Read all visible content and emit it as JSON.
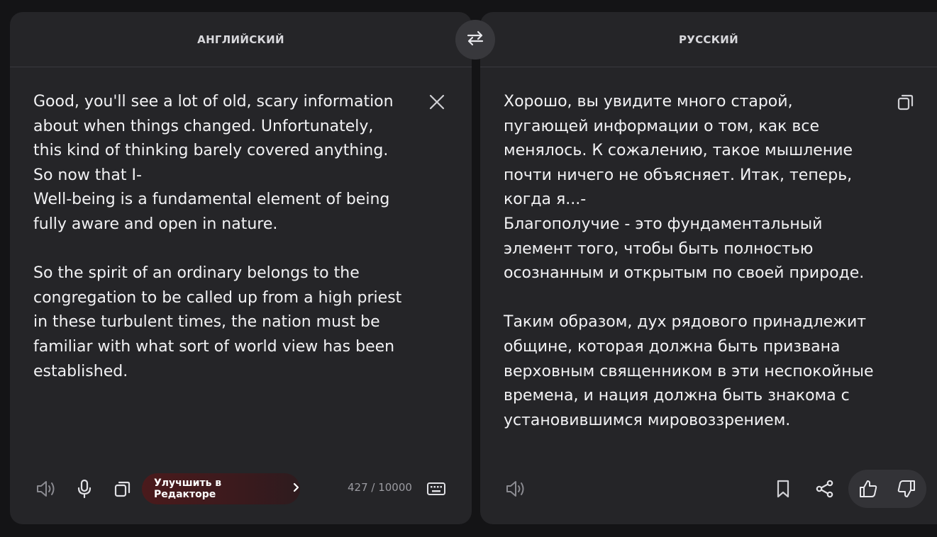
{
  "source": {
    "language": "АНГЛИЙСКИЙ",
    "text": "Good, you'll see a lot of old, scary information\nabout when things changed. Unfortunately,\nthis kind of thinking barely covered anything.\nSo now that I-\nWell-being is a fundamental element of being\nfully aware and open in nature.\n\nSo the spirit of an ordinary belongs to the\ncongregation to be called up from a high priest\nin these turbulent times, the nation must be\nfamiliar with what sort of world view has been\nestablished.",
    "improve_button_label": "Улучшить в Редакторе",
    "char_count": "427 / 10000"
  },
  "target": {
    "language": "РУССКИЙ",
    "text": "Хорошо, вы увидите много старой,\nпугающей информации о том, как все\nменялось. К сожалению, такое мышление\nпочти ничего не объясняет. Итак, теперь,\nкогда я...-\nБлагополучие - это фундаментальный\nэлемент того, чтобы быть полностью\nосознанным и открытым по своей природе.\n\nТаким образом, дух рядового принадлежит\nобщине, которая должна быть призвана\nверховным священником в эти неспокойные\nвремена, и нация должна быть знакома с\nустановившимся мировоззрением."
  },
  "icons": [
    "swap-icon",
    "clear-icon",
    "copy-icon",
    "speaker-icon",
    "microphone-icon",
    "chevron-right-icon",
    "keyboard-icon",
    "bookmark-icon",
    "share-icon",
    "thumbs-up-icon",
    "thumbs-down-icon"
  ],
  "colors": {
    "background": "#141416",
    "panel": "#252528",
    "accent_button": "#4a1a1c",
    "muted_text": "#9a9aa0"
  }
}
